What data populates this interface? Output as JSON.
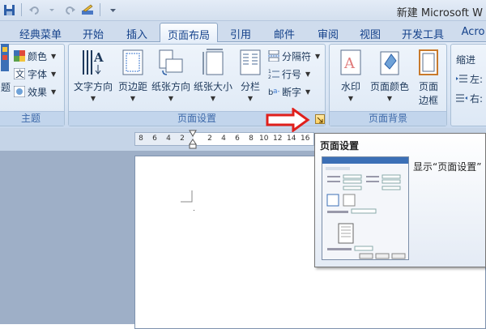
{
  "titlebar": {
    "title": "新建 Microsoft W"
  },
  "tabs": [
    {
      "label": "经典菜单"
    },
    {
      "label": "开始"
    },
    {
      "label": "插入"
    },
    {
      "label": "页面布局"
    },
    {
      "label": "引用"
    },
    {
      "label": "邮件"
    },
    {
      "label": "审阅"
    },
    {
      "label": "视图"
    },
    {
      "label": "开发工具"
    },
    {
      "label": "Acro"
    }
  ],
  "active_tab": "页面布局",
  "ribbon": {
    "theme_group": {
      "label": "主题",
      "theme_button": "题",
      "items": [
        {
          "label": "颜色"
        },
        {
          "label": "字体"
        },
        {
          "label": "效果"
        }
      ]
    },
    "page_setup_group": {
      "label": "页面设置",
      "buttons": [
        {
          "label": "文字方向"
        },
        {
          "label": "页边距"
        },
        {
          "label": "纸张方向"
        },
        {
          "label": "纸张大小"
        },
        {
          "label": "分栏"
        }
      ],
      "small": [
        {
          "label": "分隔符"
        },
        {
          "label": "行号"
        },
        {
          "label": "断字"
        }
      ]
    },
    "page_bg_group": {
      "label": "页面背景",
      "buttons": [
        {
          "label": "水印"
        },
        {
          "label": "页面颜色"
        },
        {
          "label": "页面",
          "label2": "边框"
        }
      ]
    },
    "para_group": {
      "label1": "缩进",
      "label2": "左:",
      "label3": "右:"
    }
  },
  "ruler": {
    "numbers": [
      "8",
      "6",
      "4",
      "2",
      "2",
      "4",
      "6",
      "8",
      "10",
      "12",
      "14",
      "16"
    ]
  },
  "tooltip": {
    "title": "页面设置",
    "description": "显示“页面设置”"
  },
  "colors": {
    "arrow": "#e0201c",
    "ribbon": "#dde8f5",
    "workspace": "#9eafc7"
  }
}
